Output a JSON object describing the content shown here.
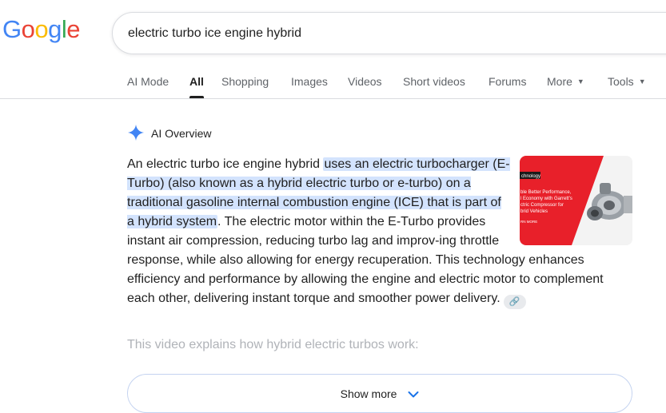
{
  "logo": {
    "letters": [
      {
        "ch": "G",
        "color": "#4285F4"
      },
      {
        "ch": "o",
        "color": "#EA4335"
      },
      {
        "ch": "o",
        "color": "#FBBC05"
      },
      {
        "ch": "g",
        "color": "#4285F4"
      },
      {
        "ch": "l",
        "color": "#34A853"
      },
      {
        "ch": "e",
        "color": "#EA4335"
      }
    ]
  },
  "search": {
    "query": "electric turbo ice engine hybrid"
  },
  "tabs": [
    {
      "label": "AI Mode"
    },
    {
      "label": "All",
      "active": true
    },
    {
      "label": "Shopping"
    },
    {
      "label": "Images"
    },
    {
      "label": "Videos"
    },
    {
      "label": "Short videos"
    },
    {
      "label": "Forums"
    },
    {
      "label": "More",
      "dropdown": true
    },
    {
      "label": "Tools",
      "dropdown": true
    }
  ],
  "ai_overview": {
    "title": "AI Overview",
    "para1_lead": "An electric turbo ice engine hybrid ",
    "para1_highlight": "uses an electric turbocharger (E-Turbo) (also known as a hybrid electric turbo or e-turbo) on a traditional gasoline internal combustion engine (ICE) that is part of a hybrid system",
    "para1_rest": ". The electric motor within the E-Turbo provides instant air compression, reducing turbo lag and improv-ing throttle response, while also allowing for energy recuperation. This technology enhances efficiency and performance by allowing the engine and electric motor to complement each other, delivering instant torque and smoother power delivery.",
    "thumbnail": {
      "tag": "chnology",
      "line1": "ble Better Performance,",
      "line2": "l Economy with Garrett's",
      "line3": "ctric Compressor for",
      "line4": "brid Vehicles",
      "cta": "RN MORE",
      "accent": "#e8202a"
    },
    "video_caption": "This video explains how hybrid electric turbos work:",
    "show_more": "Show more"
  },
  "colors": {
    "highlight": "#d3e3fd",
    "spark": "#4285F4"
  }
}
